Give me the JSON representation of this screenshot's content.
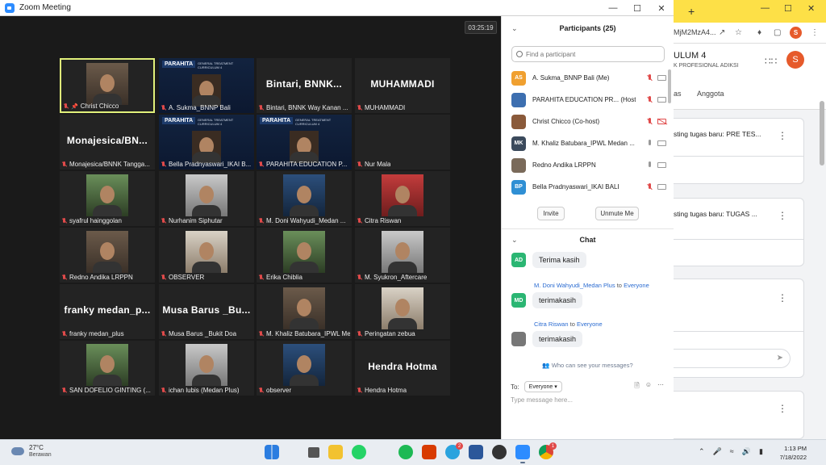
{
  "zoom": {
    "window_title": "Zoom Meeting",
    "timer": "03:25:19",
    "tiles": [
      {
        "name": "Christ Chicco",
        "kind": "cam",
        "active": true,
        "pinned": true
      },
      {
        "name": "A. Sukma_BNNP Bali",
        "kind": "banner",
        "brand": "PARAHITA"
      },
      {
        "name": "Bintari, BNNK Way Kanan ...",
        "kind": "text",
        "big": "Bintari,  BNNK..."
      },
      {
        "name": "MUHAMMADI",
        "kind": "text",
        "big": "MUHAMMADI"
      },
      {
        "name": "Monajesica/BNNK Tangga...",
        "kind": "text",
        "big": "Monajesica/BN..."
      },
      {
        "name": "Bella Pradnyaswari_IKAI B...",
        "kind": "banner",
        "brand": "PARAHITA"
      },
      {
        "name": "PARAHITA EDUCATION P...",
        "kind": "banner",
        "brand": "PARAHITA"
      },
      {
        "name": "Nur Mala",
        "kind": "empty"
      },
      {
        "name": "syafrul hainggolan",
        "kind": "cam"
      },
      {
        "name": "Nurhanim Siphutar",
        "kind": "cam"
      },
      {
        "name": "M. Doni Wahyudi_Medan ...",
        "kind": "cam"
      },
      {
        "name": "Citra Riswan",
        "kind": "cam"
      },
      {
        "name": "Redno Andika LRPPN",
        "kind": "cam"
      },
      {
        "name": "OBSERVER",
        "kind": "cam"
      },
      {
        "name": "Erika Chiblia",
        "kind": "cam"
      },
      {
        "name": "M. Syukron_Aftercare",
        "kind": "cam"
      },
      {
        "name": "franky medan_plus",
        "kind": "text",
        "big": "franky medan_p..."
      },
      {
        "name": "Musa Barus _Bukit Doa",
        "kind": "text",
        "big": "Musa Barus _Bu..."
      },
      {
        "name": "M. Khaliz Batubara_IPWL Me...",
        "kind": "cam"
      },
      {
        "name": "Peringatan zebua",
        "kind": "cam"
      },
      {
        "name": "SAN DOFELIO GINTING (...",
        "kind": "cam"
      },
      {
        "name": "ichan lubis (Medan Plus)",
        "kind": "cam"
      },
      {
        "name": "observer",
        "kind": "cam"
      },
      {
        "name": "Hendra Hotma",
        "kind": "text",
        "big": "Hendra Hotma"
      }
    ],
    "banner_sub": "GENERAL TREATMENT CURRICULUM 4",
    "participants": {
      "title": "Participants (25)",
      "search_placeholder": "Find a participant",
      "list": [
        {
          "initials": "AS",
          "color": "#f0a030",
          "name": "A. Sukma_BNNP Bali (Me)",
          "mic": "off",
          "video": "on"
        },
        {
          "initials": "",
          "color": "#3d6fb0",
          "name": "PARAHITA EDUCATION PR... (Host)",
          "mic": "off",
          "video": "on"
        },
        {
          "initials": "",
          "color": "#8a5a3a",
          "name": "Christ Chicco (Co-host)",
          "mic": "off",
          "video": "off"
        },
        {
          "initials": "MK",
          "color": "#3b4a5c",
          "name": "M. Khaliz Batubara_IPWL Medan ...",
          "mic": "on",
          "video": "on"
        },
        {
          "initials": "",
          "color": "#7a6a5a",
          "name": "Redno Andika LRPPN",
          "mic": "on",
          "video": "on"
        },
        {
          "initials": "BP",
          "color": "#2f8fd4",
          "name": "Bella Pradnyaswari_IKAI BALI",
          "mic": "off",
          "video": "on"
        }
      ],
      "invite": "Invite",
      "unmute_me": "Unmute Me"
    },
    "chat": {
      "title": "Chat",
      "messages": [
        {
          "initials": "AD",
          "color": "#2bb673",
          "sender": "",
          "to": "",
          "text": "Terima kasih"
        },
        {
          "initials": "MD",
          "color": "#2bb673",
          "sender": "M. Doni Wahyudi_Medan Plus",
          "to": "Everyone",
          "text": "terimakasih"
        },
        {
          "initials": "",
          "color": "#777777",
          "sender": "Citra Riswan",
          "to": "Everyone",
          "text": "terimakasih"
        }
      ],
      "to_word": "to",
      "who_can_see": "Who can see your messages?",
      "to_label": "To:",
      "to_value": "Everyone",
      "placeholder": "Type message here..."
    }
  },
  "chrome": {
    "url_fragment": "MjM2MzA4...",
    "profile": "S",
    "class_title": "ULUM 4",
    "class_sub": "K PROFESIONAL ADIKSI",
    "tab_left": "as",
    "tab_anggota": "Anggota",
    "posts": [
      "sting tugas baru: PRE TES...",
      "sting tugas baru: TUGAS ..."
    ]
  },
  "taskbar": {
    "temp": "27°C",
    "condition": "Berawan",
    "time": "1:13 PM",
    "date": "7/18/2022",
    "telegram_badge": "2",
    "chrome_badge": "1"
  }
}
